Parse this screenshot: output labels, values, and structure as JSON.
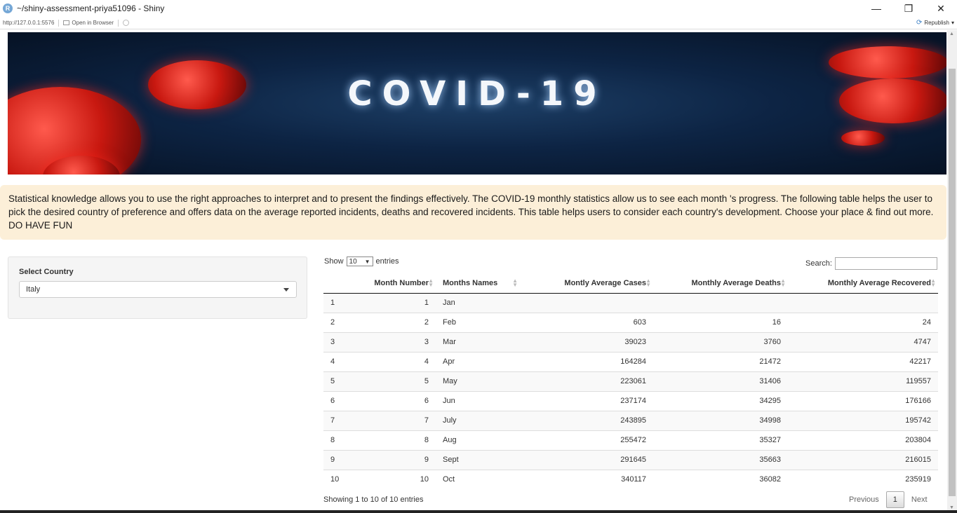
{
  "window": {
    "title": "~/shiny-assessment-priya51096 - Shiny",
    "logo": "R",
    "minimize": "—",
    "restore": "❐",
    "close": "✕"
  },
  "toolbar": {
    "url": "http://127.0.0.1:5576",
    "open_in_browser": "Open in Browser",
    "republish": "Republish",
    "republish_caret": "▾"
  },
  "banner": {
    "title": "COVID-19"
  },
  "description": "Statistical knowledge allows you to use the right approaches to interpret and to present the findings effectively. The COVID-19 monthly statistics allow us to see each month 's progress. The following table helps the user to pick the desired country of preference and offers data on the average reported incidents, deaths and recovered incidents. This table helps users to consider each country's development. Choose your place & find out more. DO HAVE FUN",
  "sidebar": {
    "label": "Select Country",
    "selected": "Italy"
  },
  "table_controls": {
    "show": "Show",
    "length_value": "10",
    "entries": "entries",
    "search_label": "Search:"
  },
  "table": {
    "headers": [
      "",
      "Month Number",
      "Months Names",
      "Montly Average Cases",
      "Monthly Average Deaths",
      "Monthly Average Recovered"
    ],
    "rows": [
      [
        "1",
        "1",
        "Jan",
        "",
        "",
        ""
      ],
      [
        "2",
        "2",
        "Feb",
        "603",
        "16",
        "24"
      ],
      [
        "3",
        "3",
        "Mar",
        "39023",
        "3760",
        "4747"
      ],
      [
        "4",
        "4",
        "Apr",
        "164284",
        "21472",
        "42217"
      ],
      [
        "5",
        "5",
        "May",
        "223061",
        "31406",
        "119557"
      ],
      [
        "6",
        "6",
        "Jun",
        "237174",
        "34295",
        "176166"
      ],
      [
        "7",
        "7",
        "July",
        "243895",
        "34998",
        "195742"
      ],
      [
        "8",
        "8",
        "Aug",
        "255472",
        "35327",
        "203804"
      ],
      [
        "9",
        "9",
        "Sept",
        "291645",
        "35663",
        "216015"
      ],
      [
        "10",
        "10",
        "Oct",
        "340117",
        "36082",
        "235919"
      ]
    ]
  },
  "footer": {
    "info": "Showing 1 to 10 of 10 entries",
    "previous": "Previous",
    "page": "1",
    "next": "Next"
  },
  "colors": {
    "description_bg": "#fcefd8",
    "banner_bg": "#0d2444",
    "virus_red": "#c81810"
  }
}
